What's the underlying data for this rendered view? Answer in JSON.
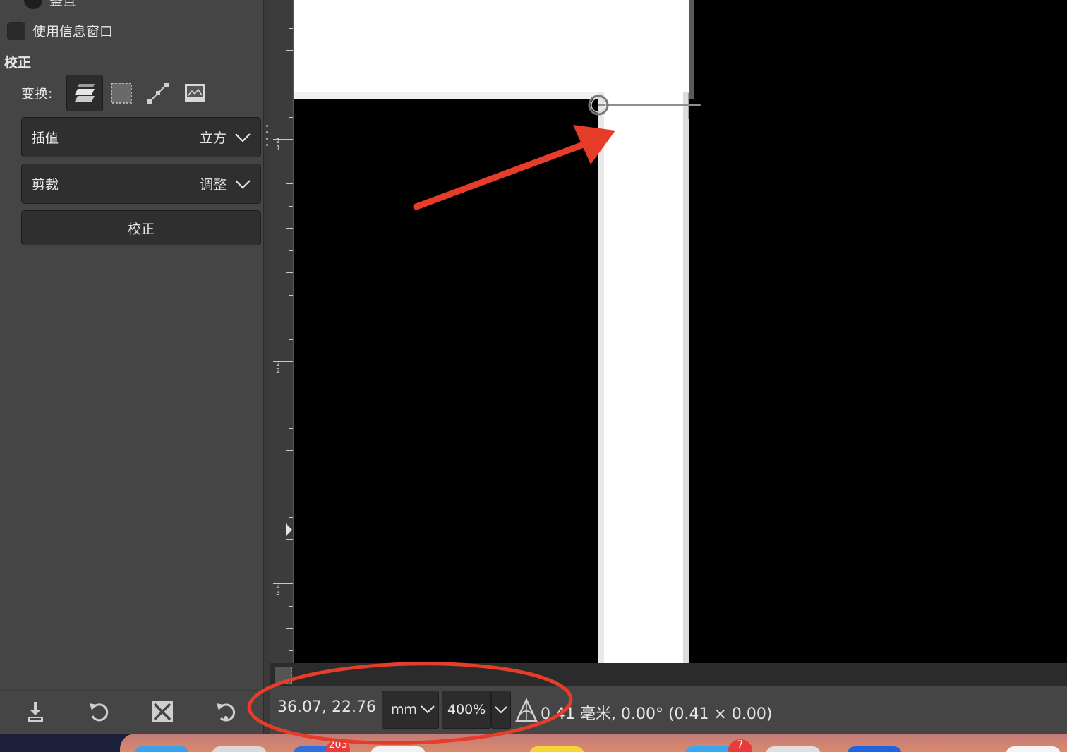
{
  "tool_options": {
    "radio_label": "鉴置",
    "checkbox_label": "使用信息窗口",
    "section_title": "校正",
    "transform_label": "变换:",
    "interpolation": {
      "label": "插值",
      "value": "立方"
    },
    "clipping": {
      "label": "剪裁",
      "value": "调整"
    },
    "apply_button": "校正"
  },
  "bottom_icons": [
    "save-preset-icon",
    "restore-icon",
    "delete-preset-icon",
    "reset-icon"
  ],
  "ruler": {
    "labels": [
      "21",
      "22",
      "23"
    ]
  },
  "statusbar": {
    "coords": "36.07, 22.76",
    "unit": "mm",
    "zoom": "400%",
    "measure": "0.41 毫米, 0.00° (0.41 × 0.00)"
  },
  "dock": {
    "badges": [
      "203",
      "7"
    ]
  },
  "colors": {
    "panel": "#454545",
    "annotation": "#e63c2a"
  }
}
